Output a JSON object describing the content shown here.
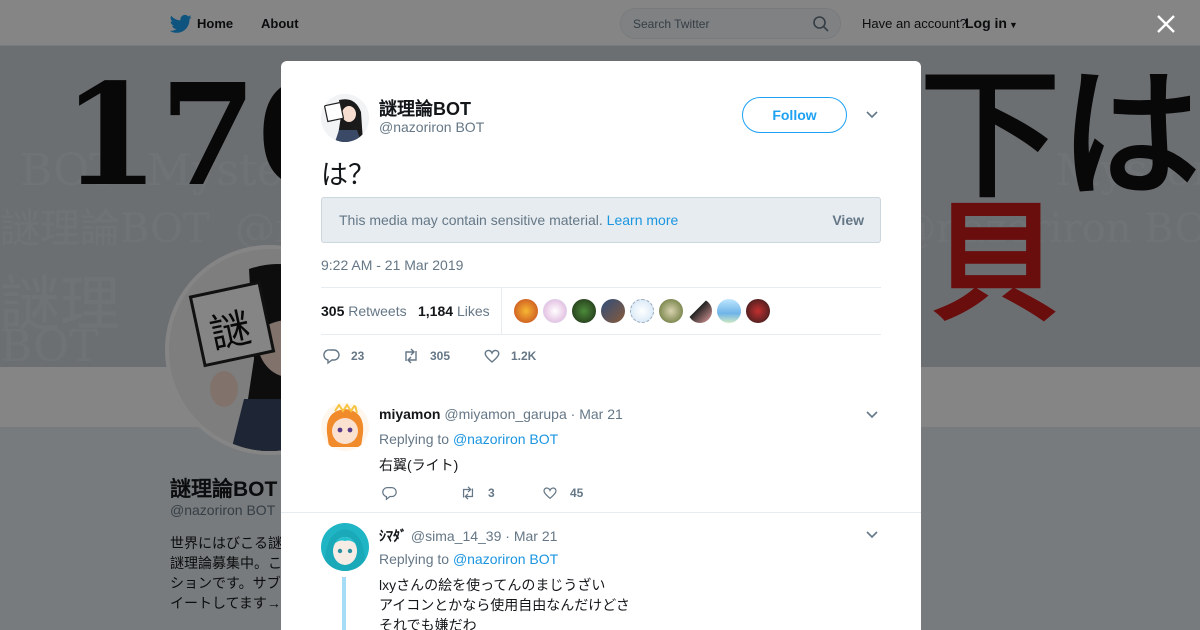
{
  "topbar": {
    "home_label": "Home",
    "about_label": "About",
    "search_placeholder": "Search Twitter",
    "have_account": "Have an account?",
    "login_label": "Log in"
  },
  "profile": {
    "name": "謎理論BOT",
    "handle": "@nazoriron BOT",
    "bio": "世界にはびこる謎\n謎理論募集中。こ\nションです。サブ\nイートしてます→",
    "banner_big_left": "170",
    "banner_big_right": "下は",
    "banner_red": "貝",
    "avatar_sign": "謎"
  },
  "tweet": {
    "name": "謎理論BOT",
    "handle": "@nazoriron BOT",
    "follow_label": "Follow",
    "text": "は？",
    "sensitive_text": "This media may contain sensitive material.",
    "learn_more": "Learn more",
    "view_label": "View",
    "timestamp": "9:22 AM - 21 Mar 2019",
    "retweets_count": "305",
    "retweets_label": "Retweets",
    "likes_count": "1,184",
    "likes_label": "Likes",
    "reply_count": "23",
    "retweet_action_count": "305",
    "like_action_count": "1.2K"
  },
  "replies": [
    {
      "name": "miyamon",
      "handle": "@miyamon_garupa",
      "date": "· Mar 21",
      "replying_prefix": "Replying to",
      "replying_to": "@nazoriron BOT",
      "text": "右翼(ライト)",
      "reply_count": "",
      "retweet_count": "3",
      "like_count": "45"
    },
    {
      "name": "ｼﾏﾀﾞ",
      "handle": "@sima_14_39",
      "date": "· Mar 21",
      "replying_prefix": "Replying to",
      "replying_to": "@nazoriron BOT",
      "text": "lxyさんの絵を使ってんのまじうざい\nアイコンとかなら使用自由なんだけどさ\nそれでも嫌だわ"
    }
  ],
  "colors": {
    "accent": "#1da1f2",
    "link": "#1b95e0",
    "muted": "#657786",
    "banner_red": "#c91a1a"
  },
  "icons": [
    "twitter-bird-icon",
    "search-icon",
    "caret-down-icon",
    "close-icon",
    "chevron-down-icon",
    "reply-icon",
    "retweet-icon",
    "heart-icon"
  ]
}
